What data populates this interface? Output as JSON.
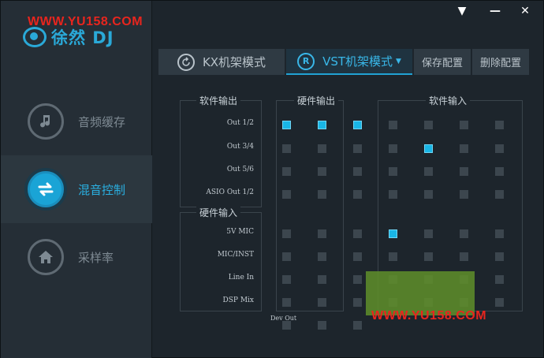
{
  "watermark": "WWW.YU158.COM",
  "app": {
    "logo_text": "徐然 DJ"
  },
  "window_controls": {
    "menu": "▼",
    "minimize": "—",
    "close": "✕"
  },
  "sidebar": {
    "items": [
      {
        "label": "音频缓存",
        "icon": "music-download-icon",
        "active": false
      },
      {
        "label": "混音控制",
        "icon": "swap-arrows-icon",
        "active": true
      },
      {
        "label": "采样率",
        "icon": "home-icon",
        "active": false
      }
    ]
  },
  "tabs": {
    "kx": {
      "label": "KX机架模式",
      "icon": "refresh-icon"
    },
    "vst": {
      "label": "VST机架模式",
      "icon_text": "R",
      "caret": "▼"
    },
    "save": {
      "label": "保存配置"
    },
    "delete": {
      "label": "删除配置"
    }
  },
  "matrix": {
    "groups": {
      "software_out": "软件输出",
      "hardware_in": "硬件输入",
      "hardware_out": "硬件输出",
      "software_in": "软件输入"
    },
    "rows": [
      {
        "label": "Out 1/2",
        "hw_out": [
          1,
          1,
          1
        ],
        "sw_in": [
          0,
          0,
          0,
          0
        ]
      },
      {
        "label": "Out 3/4",
        "hw_out": [
          0,
          0,
          0
        ],
        "sw_in": [
          0,
          1,
          0,
          0
        ]
      },
      {
        "label": "Out 5/6",
        "hw_out": [
          0,
          0,
          0
        ],
        "sw_in": [
          0,
          0,
          0,
          0
        ]
      },
      {
        "label": "ASIO Out 1/2",
        "hw_out": [
          0,
          0,
          0
        ],
        "sw_in": [
          0,
          0,
          0,
          0
        ]
      },
      {
        "label": "5V MIC",
        "hw_out": [
          0,
          0,
          0
        ],
        "sw_in": [
          1,
          0,
          0,
          0
        ]
      },
      {
        "label": "MIC/INST",
        "hw_out": [
          0,
          0,
          0
        ],
        "sw_in": [
          0,
          0,
          0,
          0
        ]
      },
      {
        "label": "Line In",
        "hw_out": [
          0,
          0,
          0
        ],
        "sw_in": [
          0,
          0,
          0,
          0
        ]
      },
      {
        "label": "DSP Mix",
        "hw_out": [
          0,
          0,
          0
        ],
        "sw_in": [
          0,
          0,
          0,
          0
        ]
      },
      {
        "label": "Dev Out",
        "hw_out": [
          0,
          0,
          0
        ],
        "sw_in": [
          0,
          0,
          0,
          0
        ]
      }
    ]
  }
}
